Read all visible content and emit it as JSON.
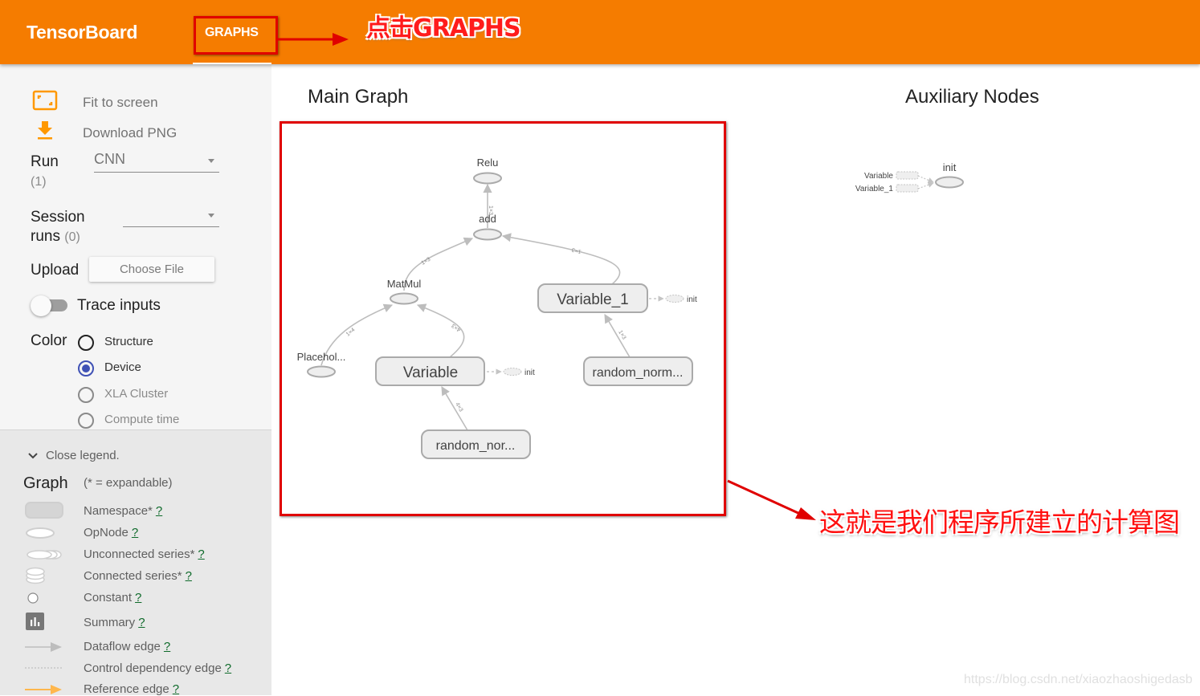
{
  "header": {
    "brand": "TensorBoard",
    "tabs": [
      {
        "label": "GRAPHS",
        "active": true
      }
    ],
    "accent_color": "#f57c00"
  },
  "annotations": {
    "top_callout": "点击GRAPHS",
    "bottom_callout": "这就是我们程序所建立的计算图",
    "color": "#e00000"
  },
  "sidebar": {
    "fit_to_screen": {
      "label": "Fit to screen",
      "icon": "fit-screen-icon"
    },
    "download_png": {
      "label": "Download PNG",
      "icon": "download-icon"
    },
    "run": {
      "label": "Run",
      "count": "(1)",
      "selected": "CNN"
    },
    "session_runs": {
      "label_line1": "Session",
      "label_line2": "runs",
      "count": "(0)",
      "selected": ""
    },
    "upload": {
      "label": "Upload",
      "button": "Choose File"
    },
    "trace_inputs": {
      "label": "Trace inputs",
      "enabled": false
    },
    "color": {
      "label": "Color",
      "options": [
        {
          "label": "Structure",
          "selected": false
        },
        {
          "label": "Device",
          "selected": true
        },
        {
          "label": "XLA Cluster",
          "selected": false
        },
        {
          "label": "Compute time",
          "selected": false
        }
      ]
    }
  },
  "legend": {
    "toggle": "Close legend.",
    "title": "Graph",
    "subtitle": "(* = expandable)",
    "help": "?",
    "items": [
      {
        "label": "Namespace*",
        "icon": "namespace-icon"
      },
      {
        "label": "OpNode",
        "icon": "opnode-icon"
      },
      {
        "label": "Unconnected series*",
        "icon": "unconnected-series-icon"
      },
      {
        "label": "Connected series*",
        "icon": "connected-series-icon"
      },
      {
        "label": "Constant",
        "icon": "constant-icon"
      },
      {
        "label": "Summary",
        "icon": "summary-icon"
      },
      {
        "label": "Dataflow edge",
        "icon": "dataflow-edge-icon"
      },
      {
        "label": "Control dependency edge",
        "icon": "control-edge-icon"
      },
      {
        "label": "Reference edge",
        "icon": "reference-edge-icon"
      }
    ]
  },
  "main_graph": {
    "title": "Main Graph",
    "nodes": {
      "relu": "Relu",
      "add": "add",
      "matmul": "MatMul",
      "placeholder": "Placehol...",
      "variable": "Variable",
      "variable_1": "Variable_1",
      "random_norm_a": "random_nor...",
      "random_norm_b": "random_norm...",
      "init": "init"
    },
    "edges": {
      "add_relu": "1×3",
      "matmul_add": "1×3",
      "var1_add": "1×3",
      "placeholder_matmul": "1×4",
      "variable_matmul": "4×3",
      "random_variable": "4×3",
      "random_var1": "1×3"
    }
  },
  "auxiliary": {
    "title": "Auxiliary Nodes",
    "inputs": [
      "Variable",
      "Variable_1"
    ],
    "node": "init"
  },
  "watermark": "https://blog.csdn.net/xiaozhaoshigedasb"
}
